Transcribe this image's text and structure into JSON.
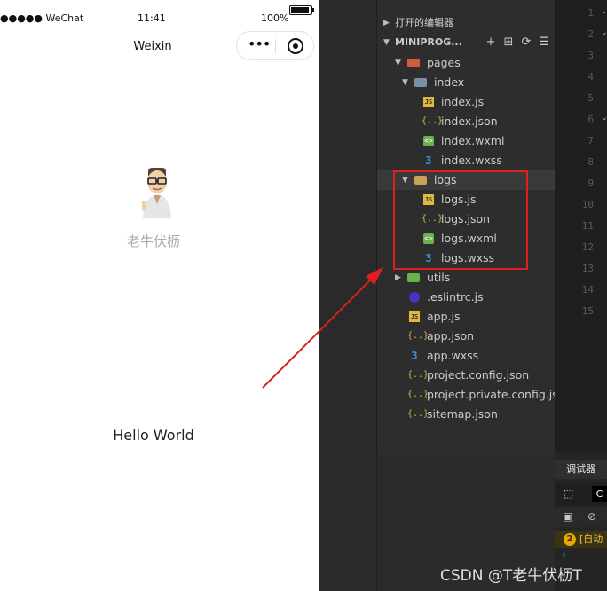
{
  "simulator": {
    "status_left": "●●●●● WeChat",
    "status_time": "11:41",
    "status_battery": "100%",
    "nav_title": "Weixin",
    "capsule_more": "•••",
    "nickname": "老牛伏枥",
    "hello": "Hello World"
  },
  "explorer": {
    "section_open_editors": "打开的编辑器",
    "section_project": "MINIPROG...",
    "items": [
      {
        "label": "pages"
      },
      {
        "label": "index"
      },
      {
        "label": "index.js"
      },
      {
        "label": "index.json"
      },
      {
        "label": "index.wxml"
      },
      {
        "label": "index.wxss"
      },
      {
        "label": "logs"
      },
      {
        "label": "logs.js"
      },
      {
        "label": "logs.json"
      },
      {
        "label": "logs.wxml"
      },
      {
        "label": "logs.wxss"
      },
      {
        "label": "utils"
      },
      {
        "label": ".eslintrc.js"
      },
      {
        "label": "app.js"
      },
      {
        "label": "app.json"
      },
      {
        "label": "app.wxss"
      },
      {
        "label": "project.config.json"
      },
      {
        "label": "project.private.config.js..."
      },
      {
        "label": "sitemap.json"
      }
    ]
  },
  "editor": {
    "line_numbers": [
      "1",
      "2",
      "3",
      "4",
      "5",
      "6",
      "7",
      "8",
      "9",
      "10",
      "11",
      "12",
      "13",
      "14",
      "15"
    ]
  },
  "debugger": {
    "tab_label": "调试器",
    "mini_tab": "C",
    "warning_count": "2",
    "warning_text": "[自动"
  },
  "watermark": "CSDN @T老牛伏枥T",
  "colors": {
    "highlight": "#e01f1f",
    "arrow": "#e01f1f"
  }
}
